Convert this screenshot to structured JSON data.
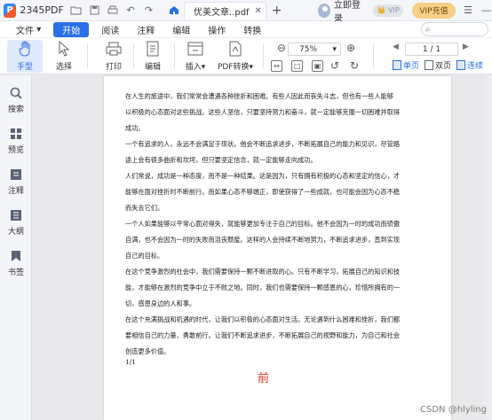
{
  "app": {
    "name": "2345PDF",
    "logo_letter": "P",
    "doc_tab": "优美文章..pdf",
    "login": "立即登录",
    "vip_badge": "VIP",
    "vip_charge": "VIP充值"
  },
  "menu": {
    "file": "文件",
    "file_arrow": "▾",
    "items": [
      "开始",
      "阅读",
      "注释",
      "编辑",
      "操作",
      "转换"
    ],
    "active": "开始"
  },
  "toolbar": {
    "hand": "手型",
    "select": "选择",
    "print": "打印",
    "edit": "编辑",
    "insert": "插入",
    "pdf_convert": "PDF转换",
    "zoom": "75%",
    "page_indicator": "1 / 1",
    "single": "单页",
    "double": "双页",
    "continuous": "连续"
  },
  "sidebar": {
    "items": [
      "搜索",
      "预览",
      "注释",
      "大纲",
      "书签"
    ]
  },
  "document": {
    "lines": [
      "在人生的旅途中，我们常常会遭遇各种挫折和困难。有些人因此而丧失斗志，但也有一些人能够",
      "以积极的心态面对这些挑战。这些人坚信，只要坚持努力和奋斗，就一定能够克服一切困难并取得",
      "成功。",
      "一个有追求的人，永远不会满足于现状。他会不断追求进步，不断拓展自己的能力和见识，尽管路",
      "途上会有很多曲折和坎坷，但只要坚定信念，就一定能够走向成功。",
      "人们常说，成功是一种态度，而不是一种结果。这是因为，只有拥有积极的心态和坚定的信心，才",
      "能够在面对挫折时不断前行。而如果心态不够端正，即使获得了一些成就，也可能会因为心态不稳",
      "而失去它们。",
      "一个人如果能够以平常心面对得失，就能够更加专注于自己的目标。他不会因为一时的成功而骄傲",
      "自满，也不会因为一时的失败而沮丧颓废。这样的人会持续不断地努力，不断追求进步，直到实现",
      "自己的目标。",
      "在这个竞争激烈的社会中，我们需要保持一颗不断进取的心。只有不断学习，拓展自己的知识和技",
      "能，才能够在激烈的竞争中立于不败之地。同时，我们也需要保持一颗感恩的心，珍惜所拥有的一",
      "切，感恩身边的人和事。",
      "在这个充满挑战和机遇的时代，让我们以积极的心态面对生活。无论遇到什么困难和挫折，我们都",
      "要相信自己的力量，勇敢前行。让我们不断追求进步，不断拓展自己的视野和能力，为自己和社会",
      "创造更多价值。"
    ],
    "page_number": "1/1",
    "front_label": "前"
  },
  "watermark": "CSDN @hlyling",
  "colors": {
    "accent": "#2b6fe6",
    "red_text": "#e0302a",
    "vip_gold": "#f7cf86"
  }
}
